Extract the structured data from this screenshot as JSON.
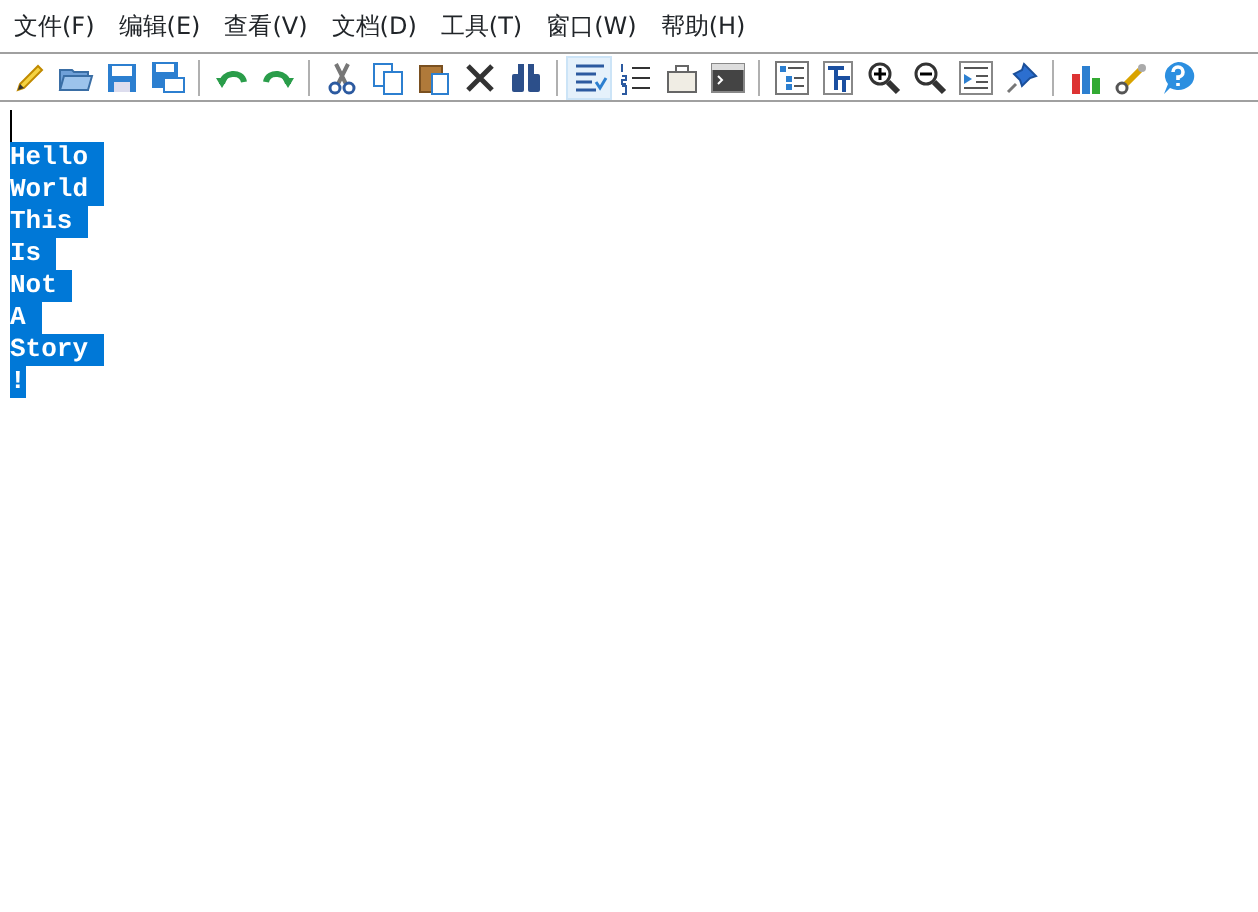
{
  "menu": [
    {
      "label": "文件(F)"
    },
    {
      "label": "编辑(E)"
    },
    {
      "label": "查看(V)"
    },
    {
      "label": "文档(D)"
    },
    {
      "label": "工具(T)"
    },
    {
      "label": "窗口(W)"
    },
    {
      "label": "帮助(H)"
    }
  ],
  "toolbar": [
    [
      {
        "pressed": false
      },
      {
        "pressed": false
      },
      {
        "pressed": false
      },
      {
        "pressed": false
      }
    ],
    [
      {
        "pressed": false
      },
      {
        "pressed": false
      }
    ],
    [
      {
        "pressed": false
      },
      {
        "pressed": false
      },
      {
        "pressed": false
      },
      {
        "pressed": false
      },
      {
        "pressed": false
      }
    ],
    [
      {
        "pressed": true
      },
      {
        "pressed": false
      },
      {
        "pressed": false
      },
      {
        "pressed": false
      }
    ],
    [
      {
        "pressed": false
      },
      {
        "pressed": false
      },
      {
        "pressed": false
      },
      {
        "pressed": false
      },
      {
        "pressed": false
      },
      {
        "pressed": false
      }
    ],
    [
      {
        "pressed": false
      },
      {
        "pressed": false
      },
      {
        "pressed": false
      }
    ]
  ],
  "editor": {
    "lines": [
      {
        "selected": false,
        "cursor": true
      },
      {
        "text": "Hello",
        "selected": true,
        "cursor": false
      },
      {
        "text": "World",
        "selected": true,
        "cursor": false
      },
      {
        "text": "This",
        "selected": true,
        "cursor": false
      },
      {
        "text": "Is",
        "selected": true,
        "cursor": false
      },
      {
        "text": "Not",
        "selected": true,
        "cursor": false
      },
      {
        "text": "A",
        "selected": true,
        "cursor": false
      },
      {
        "text": "Story",
        "selected": true,
        "cursor": false
      },
      {
        "text": "!",
        "selected": true,
        "cursor": false
      }
    ]
  }
}
